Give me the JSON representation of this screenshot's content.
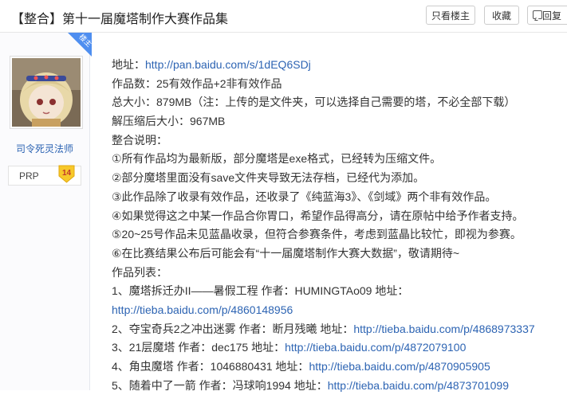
{
  "header": {
    "title": "【整合】第十一届魔塔制作大赛作品集",
    "only_op_label": "只看楼主",
    "favorite_label": "收藏",
    "reply_label": "回复"
  },
  "author": {
    "badge": "楼主",
    "name": "司令死灵法师",
    "prp_label": "PRP",
    "level": "14"
  },
  "post": {
    "address_label": "地址：",
    "address_url": "http://pan.baidu.com/s/1dEQ6SDj",
    "count": "作品数：25有效作品+2非有效作品",
    "size": "总大小：879MB（注：上传的是文件夹，可以选择自己需要的塔，不必全部下载）",
    "unzipped": "解压缩后大小：967MB",
    "notes_title": "整合说明：",
    "notes": [
      "①所有作品均为最新版，部分魔塔是exe格式，已经转为压缩文件。",
      "②部分魔塔里面没有save文件夹导致无法存档，已经代为添加。",
      "③此作品除了收录有效作品，还收录了《纯蓝海3》、《剑域》两个非有效作品。",
      "④如果觉得这之中某一作品合你胃口，希望作品得高分，请在原帖中给予作者支持。",
      "⑤20~25号作品未见蓝晶收录，但符合参赛条件，考虑到蓝晶比较忙，即视为参赛。",
      "⑥在比赛结果公布后可能会有“十一届魔塔制作大赛大数据”，敬请期待~"
    ],
    "list_title": "作品列表：",
    "works": [
      {
        "text": "1、魔塔拆迁办II——暑假工程 作者：HUMINGTAo09 地址：",
        "url": ""
      },
      {
        "text": "",
        "url": "http://tieba.baidu.com/p/4860148956"
      },
      {
        "text": "2、夺宝奇兵2之冲出迷雾 作者：断月残曦 地址：",
        "url": "http://tieba.baidu.com/p/4868973337"
      },
      {
        "text": "3、21层魔塔 作者：dec175 地址：",
        "url": "http://tieba.baidu.com/p/4872079100"
      },
      {
        "text": "4、角虫魔塔 作者：1046880431 地址：",
        "url": "http://tieba.baidu.com/p/4870905905"
      },
      {
        "text": "5、随着中了一箭 作者：冯球响1994 地址：",
        "url": "http://tieba.baidu.com/p/4873701099"
      }
    ]
  }
}
